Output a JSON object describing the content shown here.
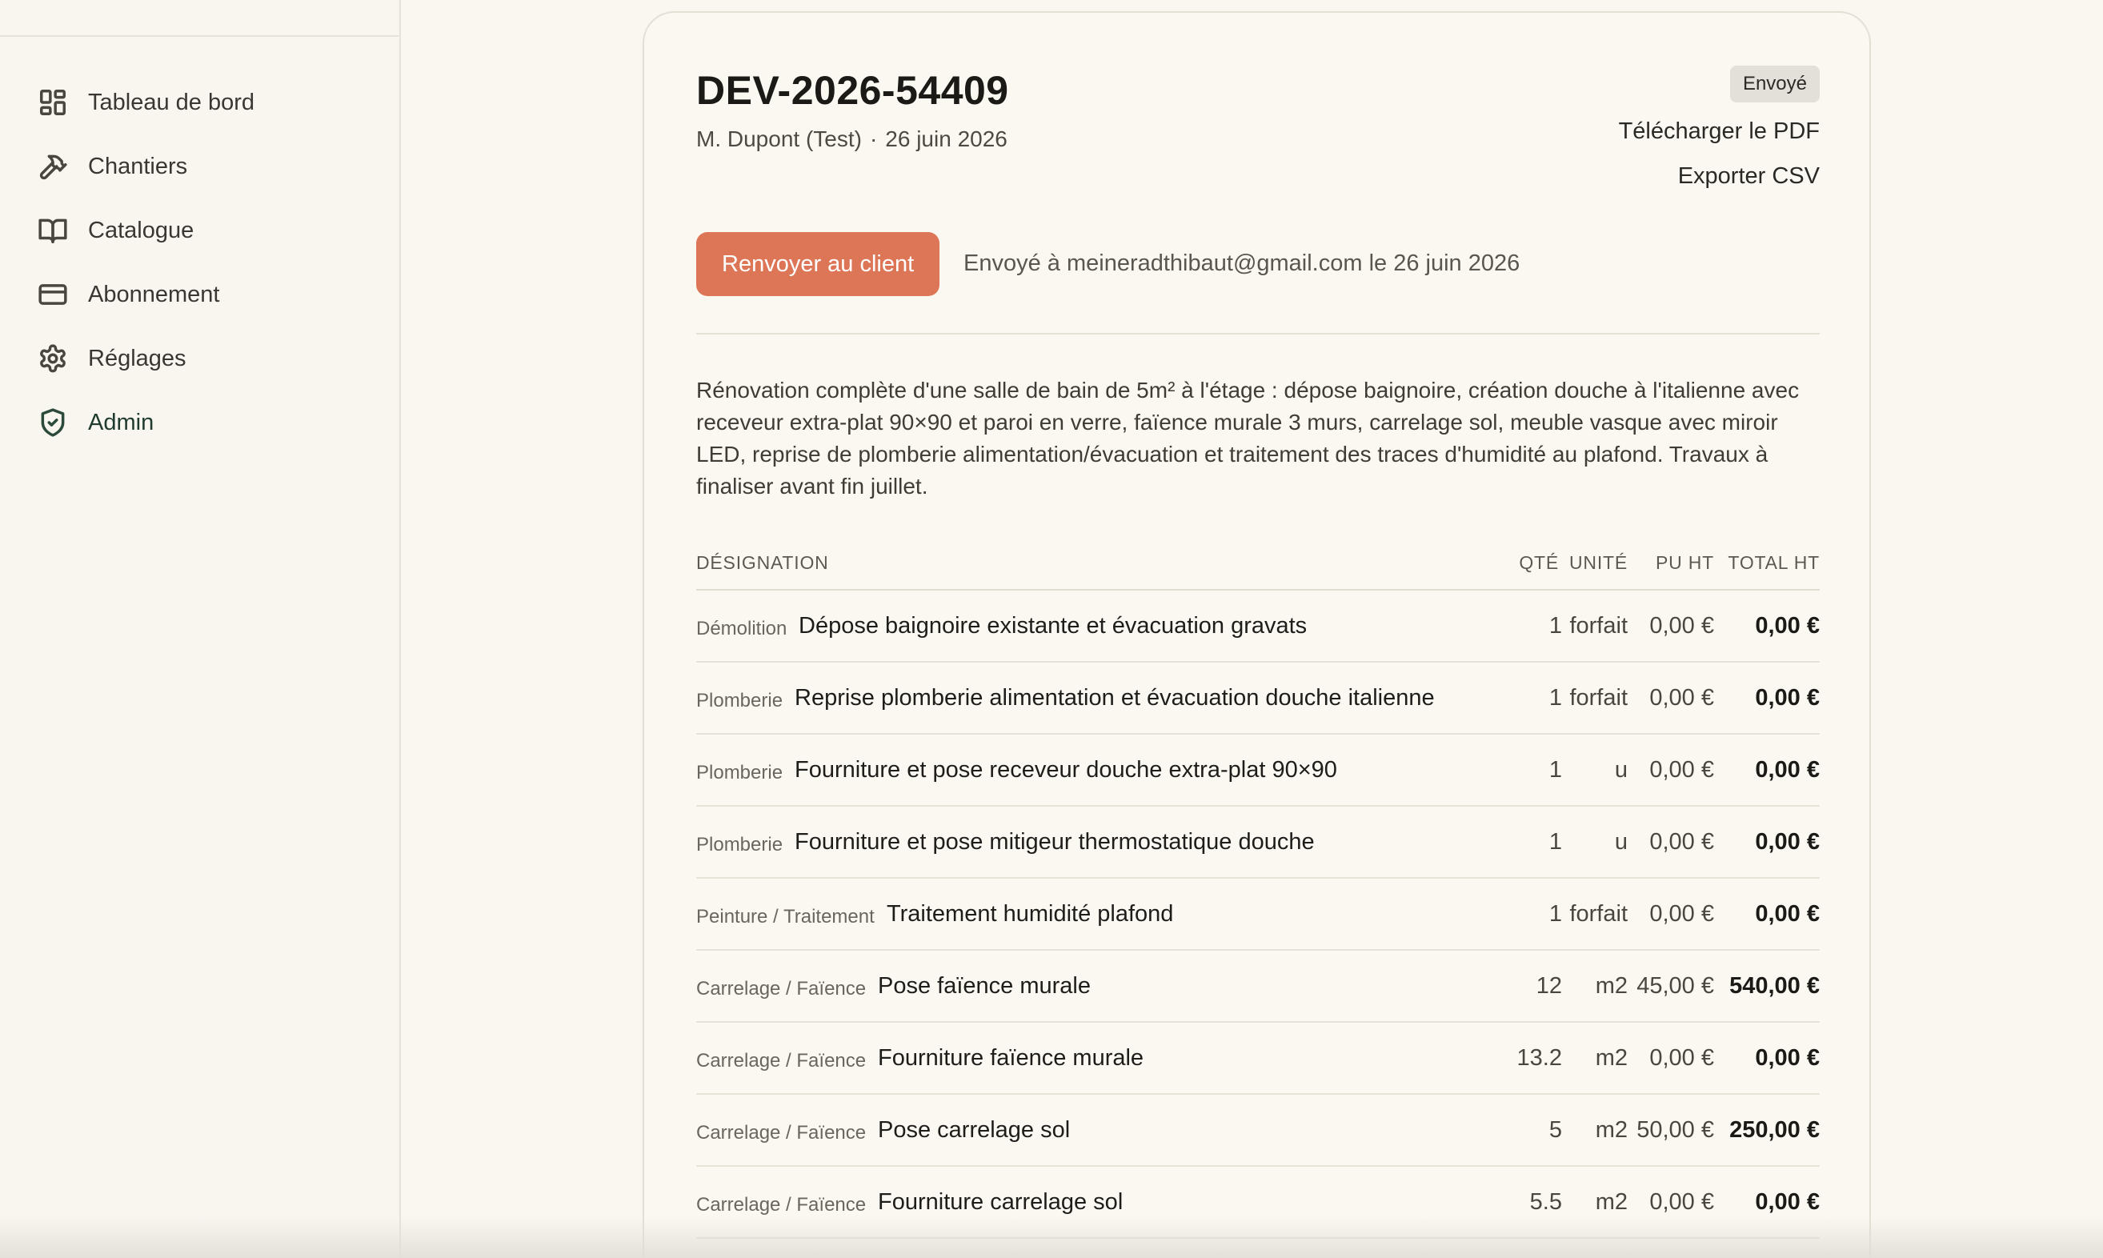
{
  "sidebar": {
    "items": [
      {
        "label": "Tableau de bord",
        "icon": "dashboard-icon"
      },
      {
        "label": "Chantiers",
        "icon": "hammer-icon"
      },
      {
        "label": "Catalogue",
        "icon": "book-icon"
      },
      {
        "label": "Abonnement",
        "icon": "credit-card-icon"
      },
      {
        "label": "Réglages",
        "icon": "gear-icon"
      },
      {
        "label": "Admin",
        "icon": "shield-icon"
      }
    ]
  },
  "quote": {
    "number": "DEV-2026-54409",
    "client": "M. Dupont (Test)",
    "separator": "·",
    "date": "26 juin 2026",
    "status": "Envoyé",
    "download_pdf": "Télécharger le PDF",
    "export_csv": "Exporter CSV",
    "resend_label": "Renvoyer au client",
    "sent_info": "Envoyé à meineradthibaut@gmail.com le 26 juin 2026",
    "description": "Rénovation complète d'une salle de bain de 5m² à l'étage : dépose baignoire, création douche à l'italienne avec receveur extra-plat 90×90 et paroi en verre, faïence murale 3 murs, carrelage sol, meuble vasque avec miroir LED, reprise de plomberie alimentation/évacuation et traitement des traces d'humidité au plafond. Travaux à finaliser avant fin juillet."
  },
  "table": {
    "headers": {
      "designation": "DÉSIGNATION",
      "qte": "QTÉ",
      "unite": "UNITÉ",
      "pu": "PU HT",
      "total": "TOTAL HT"
    },
    "rows": [
      {
        "category": "Démolition",
        "label": "Dépose baignoire existante et évacuation gravats",
        "qty": "1",
        "unit": "forfait",
        "pu": "0,00 €",
        "total": "0,00 €"
      },
      {
        "category": "Plomberie",
        "label": "Reprise plomberie alimentation et évacuation douche italienne",
        "qty": "1",
        "unit": "forfait",
        "pu": "0,00 €",
        "total": "0,00 €"
      },
      {
        "category": "Plomberie",
        "label": "Fourniture et pose receveur douche extra-plat 90×90",
        "qty": "1",
        "unit": "u",
        "pu": "0,00 €",
        "total": "0,00 €"
      },
      {
        "category": "Plomberie",
        "label": "Fourniture et pose mitigeur thermostatique douche",
        "qty": "1",
        "unit": "u",
        "pu": "0,00 €",
        "total": "0,00 €"
      },
      {
        "category": "Peinture / Traitement",
        "label": "Traitement humidité plafond",
        "qty": "1",
        "unit": "forfait",
        "pu": "0,00 €",
        "total": "0,00 €"
      },
      {
        "category": "Carrelage / Faïence",
        "label": "Pose faïence murale",
        "qty": "12",
        "unit": "m2",
        "pu": "45,00 €",
        "total": "540,00 €"
      },
      {
        "category": "Carrelage / Faïence",
        "label": "Fourniture faïence murale",
        "qty": "13.2",
        "unit": "m2",
        "pu": "0,00 €",
        "total": "0,00 €"
      },
      {
        "category": "Carrelage / Faïence",
        "label": "Pose carrelage sol",
        "qty": "5",
        "unit": "m2",
        "pu": "50,00 €",
        "total": "250,00 €"
      },
      {
        "category": "Carrelage / Faïence",
        "label": "Fourniture carrelage sol",
        "qty": "5.5",
        "unit": "m2",
        "pu": "0,00 €",
        "total": "0,00 €"
      }
    ]
  },
  "colors": {
    "accent": "#dd7656",
    "background": "#f9f7f0",
    "admin": "#1f3a2e"
  }
}
